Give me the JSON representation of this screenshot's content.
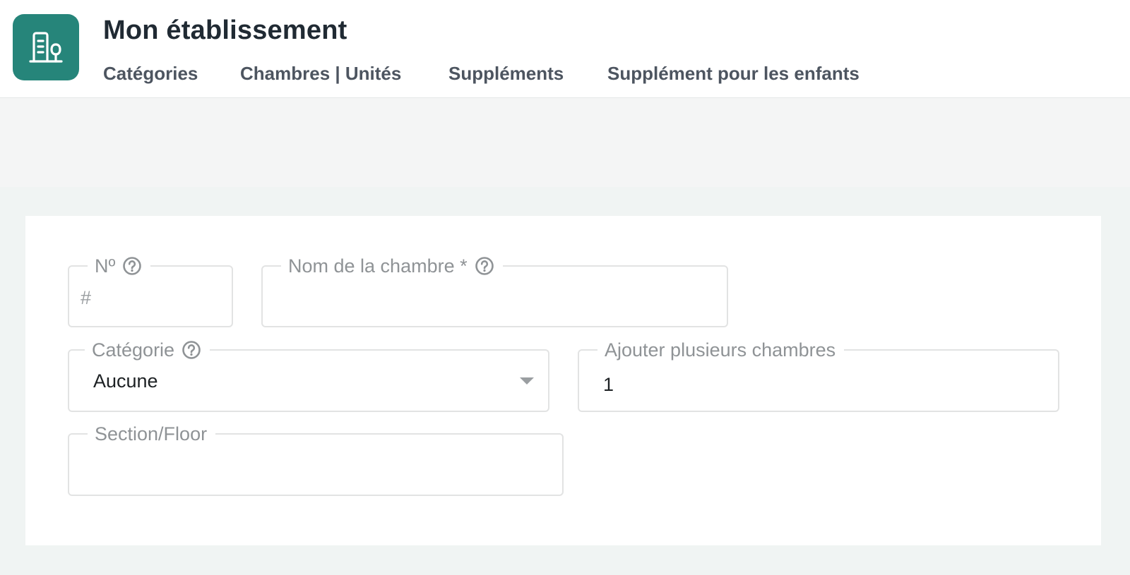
{
  "header": {
    "title": "Mon établissement",
    "logo_icon": "building-tree-icon",
    "tabs": [
      {
        "label": "Catégories"
      },
      {
        "label": "Chambres | Unités"
      },
      {
        "label": "Suppléments"
      },
      {
        "label": "Supplément pour les enfants"
      }
    ]
  },
  "form": {
    "number": {
      "label": "Nº",
      "placeholder": "#",
      "value": ""
    },
    "room_name": {
      "label": "Nom de la chambre *",
      "placeholder": "",
      "value": ""
    },
    "category": {
      "label": "Catégorie",
      "selected": "Aucune"
    },
    "add_multiple": {
      "label": "Ajouter plusieurs chambres",
      "value": "1"
    },
    "section_floor": {
      "label": "Section/Floor",
      "placeholder": "",
      "value": ""
    }
  },
  "colors": {
    "brand": "#26857a",
    "background": "#f0f4f3",
    "field_border": "#e2e3e3",
    "label": "#8f9396"
  }
}
